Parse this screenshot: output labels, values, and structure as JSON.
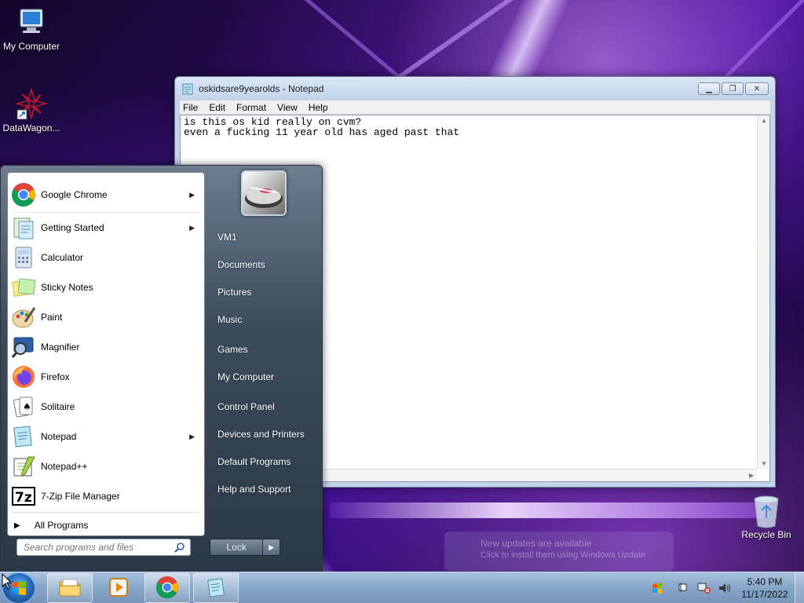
{
  "desktop": {
    "icons": [
      {
        "label": "My Computer"
      },
      {
        "label": "DataWagon..."
      },
      {
        "label": "Recycle Bin"
      }
    ]
  },
  "notepad": {
    "title": "oskidsare9yearolds - Notepad",
    "menu": [
      "File",
      "Edit",
      "Format",
      "View",
      "Help"
    ],
    "content": "is this os kid really on cvm?\neven a fucking 11 year old has aged past that"
  },
  "start_menu": {
    "programs": [
      {
        "label": "Google Chrome",
        "icon": "chrome-icon",
        "has_arrow": true
      },
      {
        "label": "Getting Started",
        "icon": "getting-started-icon",
        "has_arrow": true
      },
      {
        "label": "Calculator",
        "icon": "calculator-icon",
        "has_arrow": false
      },
      {
        "label": "Sticky Notes",
        "icon": "sticky-notes-icon",
        "has_arrow": false
      },
      {
        "label": "Paint",
        "icon": "paint-icon",
        "has_arrow": false
      },
      {
        "label": "Magnifier",
        "icon": "magnifier-icon",
        "has_arrow": false
      },
      {
        "label": "Firefox",
        "icon": "firefox-icon",
        "has_arrow": false
      },
      {
        "label": "Solitaire",
        "icon": "solitaire-icon",
        "has_arrow": false
      },
      {
        "label": "Notepad",
        "icon": "notepad-icon",
        "has_arrow": true
      },
      {
        "label": "Notepad++",
        "icon": "notepadpp-icon",
        "has_arrow": false
      },
      {
        "label": "7-Zip File Manager",
        "icon": "7zip-icon",
        "has_arrow": false
      }
    ],
    "all_programs": "All Programs",
    "search_placeholder": "Search programs and files",
    "places": [
      {
        "label": "VM1"
      },
      {
        "label": "Documents"
      },
      {
        "label": "Pictures"
      },
      {
        "label": "Music"
      },
      {
        "label": "Games"
      },
      {
        "label": "My Computer"
      },
      {
        "label": "Control Panel"
      },
      {
        "label": "Devices and Printers"
      },
      {
        "label": "Default Programs"
      },
      {
        "label": "Help and Support"
      }
    ],
    "lock_label": "Lock"
  },
  "notification": {
    "line1": "New updates are available",
    "line2": "Click to install them using Windows Update"
  },
  "taskbar": {
    "pinned": [
      "explorer-icon",
      "media-player-icon",
      "chrome-icon",
      "notepad-icon"
    ],
    "time": "5:40 PM",
    "date": "11/17/2022"
  }
}
